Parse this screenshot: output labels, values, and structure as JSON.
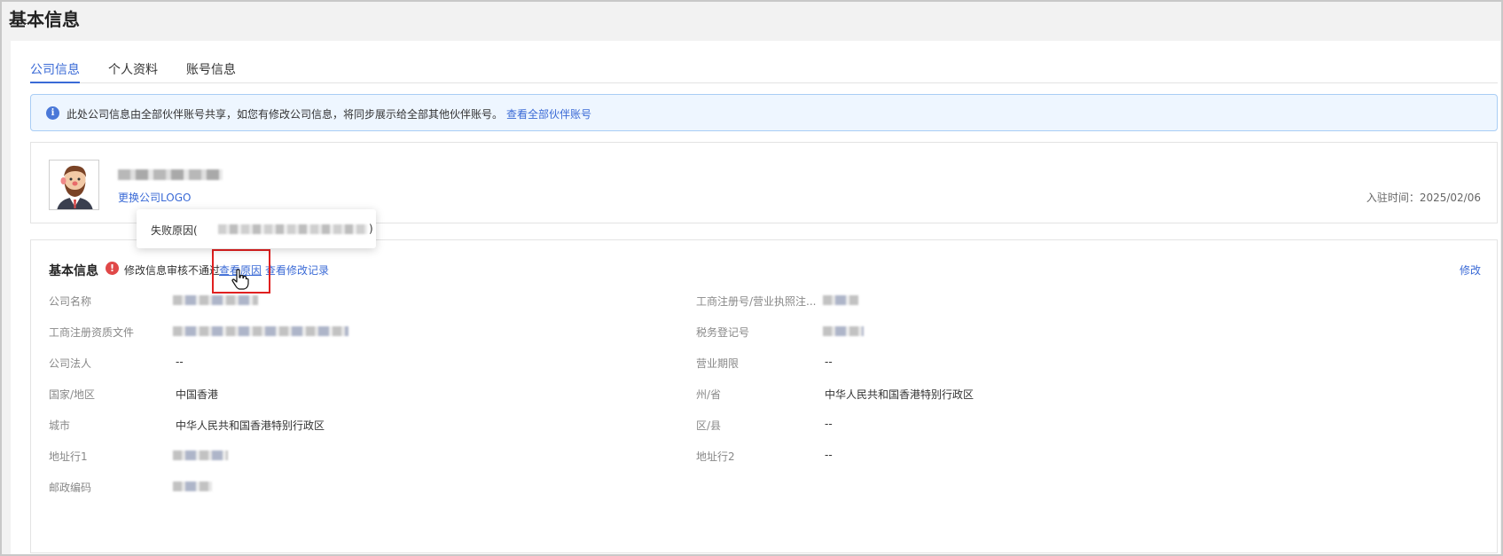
{
  "page": {
    "title": "基本信息"
  },
  "tabs": [
    {
      "label": "公司信息",
      "active": true
    },
    {
      "label": "个人资料",
      "active": false
    },
    {
      "label": "账号信息",
      "active": false
    }
  ],
  "notice": {
    "icon": "info-icon",
    "text": "此处公司信息由全部伙伴账号共享，如您有修改公司信息，将同步展示给全部其他伙伴账号。",
    "link": "查看全部伙伴账号"
  },
  "profile": {
    "change_logo": "更换公司LOGO",
    "join_time": "入驻时间：2025/02/06"
  },
  "tooltip": {
    "label": "失败原因(",
    "suffix": ")"
  },
  "basic": {
    "title": "基本信息",
    "status": "修改信息审核不通过",
    "view_reason": "查看原因",
    "view_history": "查看修改记录",
    "edit": "修改",
    "fields_left": [
      {
        "label": "公司名称",
        "value": ""
      },
      {
        "label": "工商注册资质文件",
        "value": ""
      },
      {
        "label": "公司法人",
        "value": "--"
      },
      {
        "label": "国家/地区",
        "value": "中国香港"
      },
      {
        "label": "城市",
        "value": "中华人民共和国香港特别行政区"
      },
      {
        "label": "地址行1",
        "value": ""
      },
      {
        "label": "邮政编码",
        "value": ""
      }
    ],
    "fields_right": [
      {
        "label": "工商注册号/营业执照注...",
        "value": ""
      },
      {
        "label": "税务登记号",
        "value": ""
      },
      {
        "label": "营业期限",
        "value": "--"
      },
      {
        "label": "州/省",
        "value": "中华人民共和国香港特别行政区"
      },
      {
        "label": "区/县",
        "value": "--"
      },
      {
        "label": "地址行2",
        "value": "--"
      }
    ]
  },
  "colors": {
    "accent": "#3a6ad6",
    "error": "#e04848",
    "notice_bg": "#eef6ff",
    "notice_border": "#a9cdf5"
  }
}
